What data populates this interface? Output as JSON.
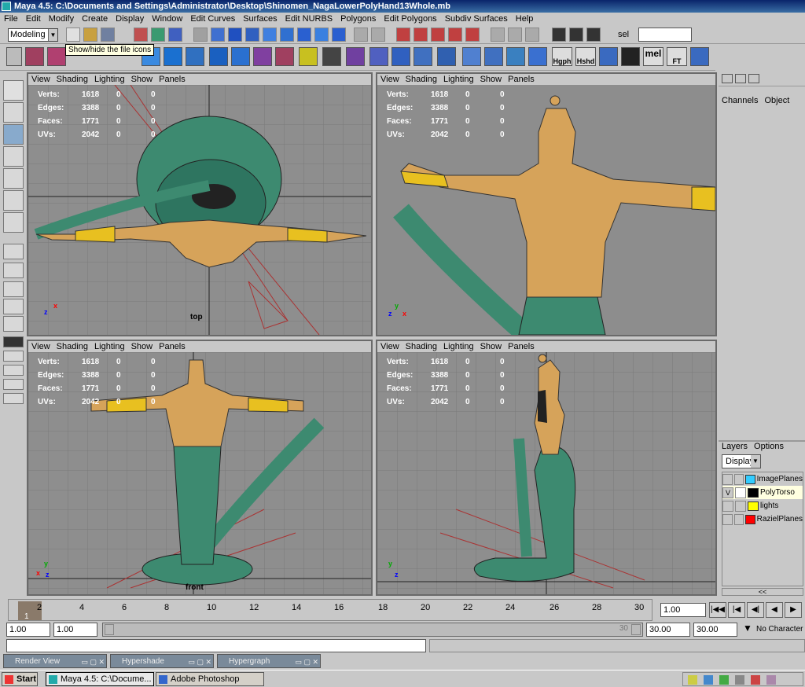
{
  "window": {
    "title": "Maya 4.5: C:\\Documents and Settings\\Administrator\\Desktop\\Shinomen_NagaLowerPolyHand13Whole.mb"
  },
  "menu": [
    "File",
    "Edit",
    "Modify",
    "Create",
    "Display",
    "Window",
    "Edit Curves",
    "Surfaces",
    "Edit NURBS",
    "Polygons",
    "Edit Polygons",
    "Subdiv Surfaces",
    "Help"
  ],
  "status_line": {
    "mode": "Modeling",
    "sel_label": "sel",
    "sel_value": ""
  },
  "tooltip": "Show/hide the file icons",
  "shelf": {
    "text_buttons": [
      "Hgph",
      "Hshd",
      "mel",
      "FT"
    ]
  },
  "panel_menu": [
    "View",
    "Shading",
    "Lighting",
    "Show",
    "Panels"
  ],
  "hud": {
    "labels": [
      "Verts:",
      "Edges:",
      "Faces:",
      "UVs:"
    ],
    "values": [
      "1618",
      "3388",
      "1771",
      "2042"
    ],
    "zero": "0"
  },
  "views": {
    "top": {
      "label": "top"
    },
    "front": {
      "label": "front"
    }
  },
  "axes": {
    "x": "x",
    "y": "y",
    "z": "z"
  },
  "channel_box": {
    "tabs": [
      "Channels",
      "Object"
    ]
  },
  "layers": {
    "tabs": [
      "Layers",
      "Options"
    ],
    "display": "Display",
    "items": [
      {
        "name": "ImagePlanes",
        "v": "",
        "color": "#33ccff"
      },
      {
        "name": "PolyTorso",
        "v": "V",
        "color": "#000000"
      },
      {
        "name": "lights",
        "v": "",
        "color": "#ffff00"
      },
      {
        "name": "RazielPlanes",
        "v": "",
        "color": "#ff0000"
      }
    ],
    "scroll": "<<"
  },
  "time": {
    "current": "1",
    "ticks": [
      "2",
      "4",
      "6",
      "8",
      "10",
      "12",
      "14",
      "16",
      "18",
      "20",
      "22",
      "24",
      "26",
      "28",
      "30"
    ],
    "current_field": "1.00"
  },
  "range": {
    "start": "1.00",
    "start2": "1.00",
    "end_marker": "30",
    "end": "30.00",
    "end2": "30.00",
    "character": "No Character S"
  },
  "minimized": [
    "Render View",
    "Hypershade",
    "Hypergraph"
  ],
  "taskbar": {
    "start": "Start",
    "tasks": [
      "Maya 4.5: C:\\Docume...",
      "Adobe Photoshop"
    ]
  },
  "colors": {
    "skin": "#d6a35a",
    "tail": "#3d8a70",
    "arm": "#e8c020",
    "wire": "#2a2a2a"
  }
}
